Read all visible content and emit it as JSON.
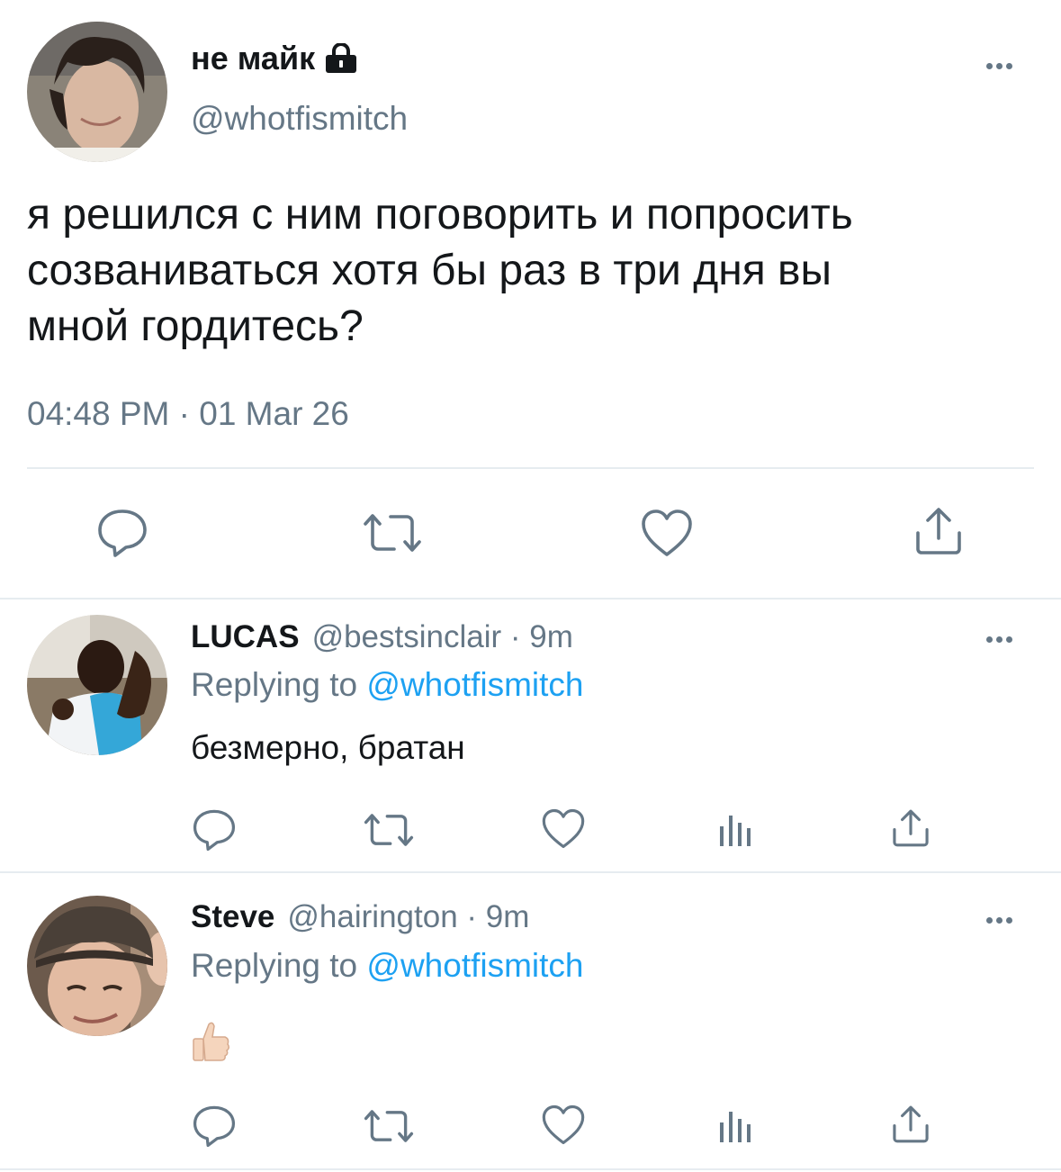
{
  "main_tweet": {
    "display_name": "не майк",
    "handle": "@whotfismitch",
    "lines": [
      "я решился с ним поговорить и попросить",
      "созваниваться хотя бы раз в три дня вы",
      "мной гордитесь?"
    ],
    "timestamp": "04:48 PM · 01 Mar 26",
    "badge_icon": "lock-icon"
  },
  "replies": [
    {
      "display_name": "LUCAS",
      "meta": "@bestsinclair · 9m",
      "replying_prefix": "Replying to",
      "replying_handle": "@whotfismitch",
      "text": "безмерно, братан"
    },
    {
      "display_name": "Steve",
      "meta": "@hairington · 9m",
      "replying_prefix": "Replying to",
      "replying_handle": "@whotfismitch",
      "text": "👍🏻"
    }
  ],
  "icons": {
    "reply": "reply-icon",
    "retweet": "retweet-icon",
    "like": "heart-icon",
    "analytics": "analytics-icon",
    "share": "share-icon",
    "more": "more-icon"
  },
  "colors": {
    "text": "#14171a",
    "secondary": "#657786",
    "link": "#1da1f2",
    "divider": "#e6ecf0"
  }
}
